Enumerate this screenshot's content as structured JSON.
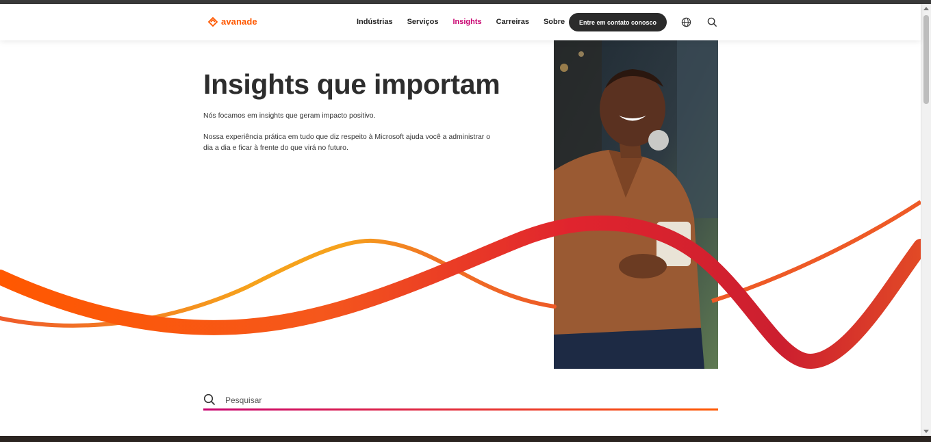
{
  "header": {
    "logo_text": "avanade",
    "nav": [
      {
        "label": "Indústrias"
      },
      {
        "label": "Serviços"
      },
      {
        "label": "Insights"
      },
      {
        "label": "Carreiras"
      },
      {
        "label": "Sobre"
      }
    ],
    "active_nav": "Insights",
    "contact_label": "Entre em contato conosco",
    "icons": [
      "globe-icon",
      "search-icon"
    ]
  },
  "hero": {
    "title": "Insights que importam",
    "paragraph1": "Nós focamos em insights que geram impacto positivo.",
    "paragraph2": "Nossa experiência prática em tudo que diz respeito à Microsoft ajuda você a administrar o dia a dia e ficar à frente do que virá no futuro."
  },
  "search": {
    "placeholder": "Pesquisar",
    "value": ""
  },
  "colors": {
    "brand_orange": "#ff5800",
    "brand_magenta": "#c8016f",
    "button_dark": "#2b2b2b",
    "text_dark": "#2d2d2d"
  }
}
